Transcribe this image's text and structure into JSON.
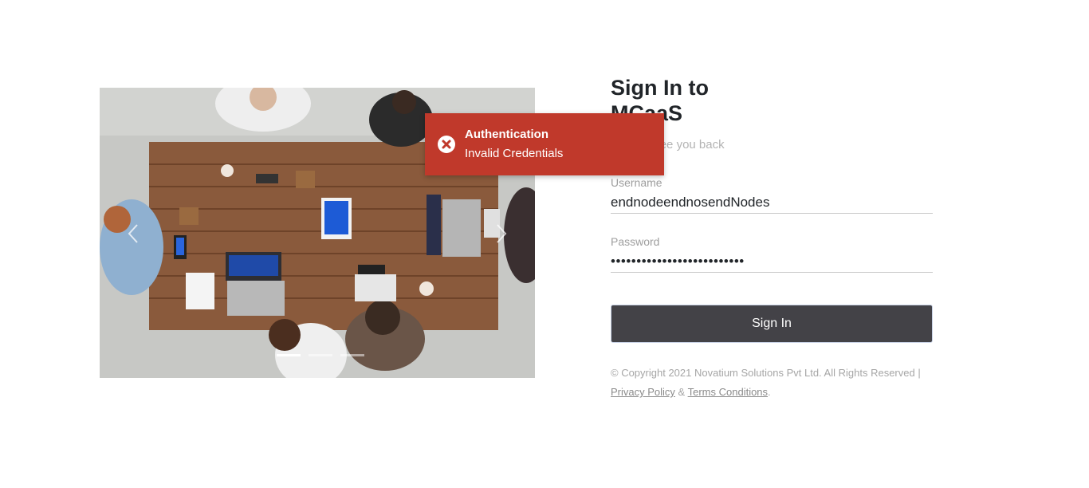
{
  "login": {
    "title": "Sign In to MCaaS",
    "subtitle": "good to see you back",
    "username_label": "Username",
    "username_value": "endnodeendnosendNodes",
    "password_label": "Password",
    "password_value": "••••••••••••••••••••••••••",
    "signin_label": "Sign In"
  },
  "footer": {
    "copyright": "© Copyright 2021 Novatium Solutions Pvt Ltd. All Rights Reserved |",
    "privacy_label": "Privacy Policy",
    "separator": "&",
    "terms_label": "Terms Conditions",
    "end": "."
  },
  "toast": {
    "title": "Authentication",
    "message": "Invalid Credentials",
    "color": "#c0392b",
    "icon": "error-circle-icon"
  },
  "carousel": {
    "slide_count": 3,
    "active_index": 0,
    "prev_icon": "chevron-left-icon",
    "next_icon": "chevron-right-icon"
  },
  "colors": {
    "button": "#434247",
    "toast": "#c0392b"
  }
}
